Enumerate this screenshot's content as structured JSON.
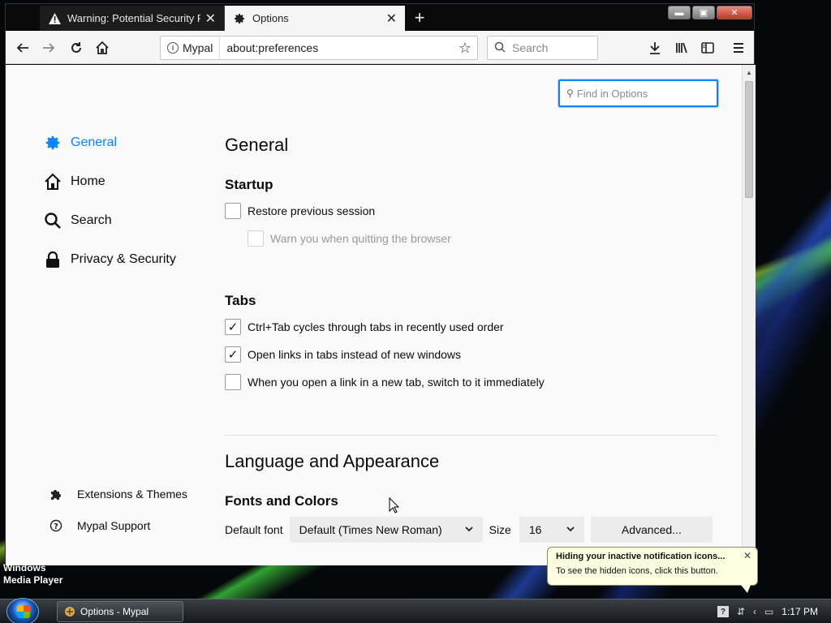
{
  "desktop": {
    "icon_label": "Windows Media Player"
  },
  "browser": {
    "tabs": [
      {
        "title": "Warning: Potential Security Risk",
        "icon": "warning-icon",
        "active": false
      },
      {
        "title": "Options",
        "icon": "gear-icon",
        "active": true
      }
    ],
    "new_tab_icon": "+",
    "url_identity": "Mypal",
    "url": "about:preferences",
    "search_placeholder": "Search"
  },
  "preferences": {
    "find_placeholder": "Find in Options",
    "categories": [
      {
        "label": "General",
        "icon": "gear-icon",
        "selected": true
      },
      {
        "label": "Home",
        "icon": "home-icon",
        "selected": false
      },
      {
        "label": "Search",
        "icon": "search-icon",
        "selected": false
      },
      {
        "label": "Privacy & Security",
        "icon": "lock-icon",
        "selected": false
      }
    ],
    "footer_links": [
      {
        "label": "Extensions & Themes",
        "icon": "puzzle-icon"
      },
      {
        "label": "Mypal Support",
        "icon": "help-icon"
      }
    ],
    "section_title": "General",
    "startup": {
      "heading": "Startup",
      "restore_session": {
        "label": "Restore previous session",
        "checked": false
      },
      "warn_quit": {
        "label": "Warn you when quitting the browser",
        "checked": false,
        "disabled": true
      }
    },
    "tabs": {
      "heading": "Tabs",
      "options": [
        {
          "label": "Ctrl+Tab cycles through tabs in recently used order",
          "checked": true
        },
        {
          "label": "Open links in tabs instead of new windows",
          "checked": true
        },
        {
          "label": "When you open a link in a new tab, switch to it immediately",
          "checked": false
        }
      ]
    },
    "language_title": "Language and Appearance",
    "fonts": {
      "heading": "Fonts and Colors",
      "default_font_label": "Default font",
      "default_font_value": "Default (Times New Roman)",
      "size_label": "Size",
      "size_value": "16",
      "advanced_label": "Advanced..."
    }
  },
  "notification": {
    "title": "Hiding your inactive notification icons...",
    "text": "To see the hidden icons, click this button."
  },
  "taskbar": {
    "window_button": "Options - Mypal",
    "clock": "1:17 PM"
  }
}
